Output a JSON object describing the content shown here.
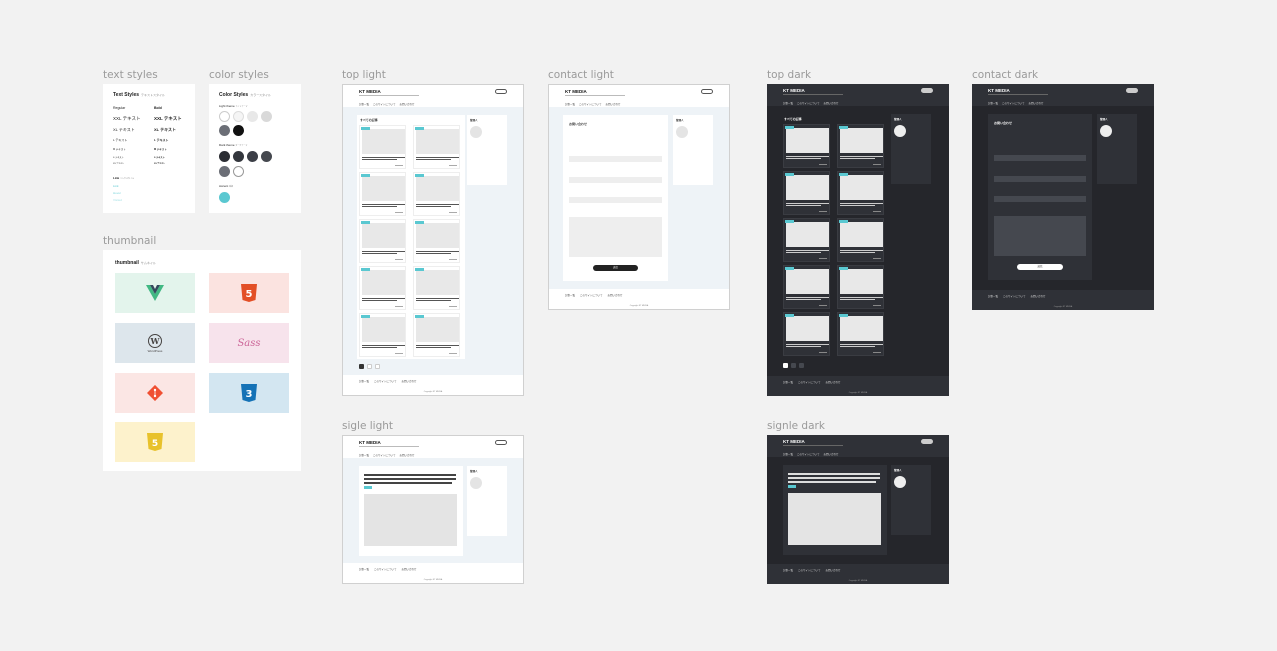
{
  "labels": {
    "text_styles": "text styles",
    "color_styles": "color styles",
    "thumbnail": "thumbnail",
    "top_light": "top light",
    "contact_light": "contact light",
    "top_dark": "top dark",
    "contact_dark": "contact dark",
    "sigle_light": "sigle light",
    "signle_dark": "signle dark"
  },
  "text_styles_card": {
    "title": "Text Styles",
    "title_sub": "テキストスタイル",
    "rows": [
      [
        "Regular",
        "Bold"
      ],
      [
        "XXL テキスト",
        "XXL テキスト"
      ],
      [
        "XL テキスト",
        "XL テキスト"
      ],
      [
        "L テキスト",
        "L テキスト"
      ],
      [
        "M テキスト",
        "M テキスト"
      ],
      [
        "S テキスト",
        "S テキスト"
      ],
      [
        "XS テキスト",
        "XS テキスト"
      ]
    ],
    "link_title": "Link",
    "link_sub": "リンクスタイル",
    "links": [
      "Link",
      "Hover",
      "Visited"
    ]
  },
  "color_styles_card": {
    "title": "Color Styles",
    "title_sub": "カラースタイル",
    "light_title": "Light theme",
    "light_sub": "ライトテーマ",
    "dark_title": "Dark theme",
    "dark_sub": "ダークテーマ",
    "accent_title": "Accent",
    "accent_sub": "強調",
    "light_colors": [
      "#ffffff",
      "#f5f5f5",
      "#e8e8e8",
      "#d9d9d9",
      "#6b6e76",
      "#111111"
    ],
    "dark_colors": [
      "#2b2d33",
      "#33363d",
      "#3b3e46",
      "#45484f",
      "#6b6e76",
      "#ffffff"
    ],
    "accent": "#5ac8d1"
  },
  "thumbnail_card": {
    "title": "thumbnail",
    "title_sub": "サムネイル",
    "tiles": [
      {
        "name": "vue",
        "bg": "#e3f4ec",
        "glyph": "V",
        "color": "#41b883"
      },
      {
        "name": "html5",
        "bg": "#fbe3e0",
        "glyph": "5",
        "color": "#e34f26"
      },
      {
        "name": "wordpress",
        "bg": "#dde6ec",
        "glyph": "W",
        "color": "#464342",
        "caption": "WordPress"
      },
      {
        "name": "sass",
        "bg": "#f7e3ec",
        "glyph": "Sass",
        "color": "#cd6799"
      },
      {
        "name": "git",
        "bg": "#fbe6e4",
        "glyph": "◆",
        "color": "#f05033"
      },
      {
        "name": "css3",
        "bg": "#d3e6f1",
        "glyph": "3",
        "color": "#1572b6"
      },
      {
        "name": "js",
        "bg": "#fdf2cc",
        "glyph": "JS",
        "color": "#e8c22c"
      }
    ]
  },
  "mockup": {
    "site_title": "KT MEDIA",
    "nav": [
      "記事一覧",
      "このサイトについて",
      "お問い合わせ"
    ],
    "section_all": "すべての記事",
    "section_contact": "お問い合わせ",
    "profile": "管理人",
    "submit": "送信",
    "footer_copy": "Copyright KT MEDIA"
  },
  "colors": {
    "accent": "#5ac8d1",
    "light_bg": "#eef3f7",
    "dark_bg": "#25262b",
    "dark_panel": "#2f3137",
    "dark_card": "#3a3c42"
  }
}
